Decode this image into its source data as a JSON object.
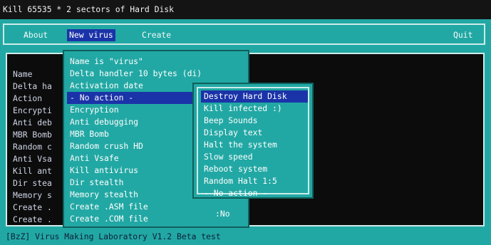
{
  "window": {
    "title": "Kill 65535 * 2 sectors of Hard Disk"
  },
  "menu": {
    "items": [
      {
        "hk": "A",
        "rest": "bout"
      },
      {
        "hk": "N",
        "rest": "ew virus"
      },
      {
        "hk": "C",
        "rest": "reate"
      },
      {
        "hk": "Q",
        "rest": "uit"
      }
    ]
  },
  "options_list": [
    "Name",
    "Delta ha",
    "Action",
    "Encrypti",
    "Anti deb",
    "MBR Bomb",
    "Random c",
    "Anti Vsa",
    "Kill ant",
    "Dir stea",
    "Memory s",
    "Create .",
    "Create ."
  ],
  "new_virus_menu": [
    {
      "hk": "N",
      "rest": "ame is \"virus\""
    },
    {
      "hk": "D",
      "rest": "elta handler 10 bytes (di)"
    },
    {
      "hk": "A",
      "rest": "ctivation date"
    },
    {
      "hk": "",
      "rest": "- No action -"
    },
    {
      "hk": "E",
      "rest": "ncryption"
    },
    {
      "hk": "A",
      "rest": "nti debugging"
    },
    {
      "hk": "M",
      "rest": "BR Bomb"
    },
    {
      "hk": "R",
      "rest": "andom crush HD"
    },
    {
      "hk": "A",
      "rest": "nti Vsafe"
    },
    {
      "hk": "K",
      "rest": "ill antivirus"
    },
    {
      "hk": "D",
      "rest": "ir stealth"
    },
    {
      "hk": "M",
      "rest": "emory stealth"
    },
    {
      "hk": "C",
      "rest": "reate .ASM file"
    },
    {
      "hk": "C",
      "rest": "reate .COM file"
    }
  ],
  "action_menu": [
    {
      "hk": "",
      "rest": "Destroy Hard Disk"
    },
    {
      "hk": "K",
      "rest": "ill infected :)"
    },
    {
      "hk": "B",
      "rest": "eep Sounds"
    },
    {
      "hk": "D",
      "rest": "isplay text"
    },
    {
      "hk": "H",
      "rest": "alt the system"
    },
    {
      "hk": "S",
      "rest": "low speed"
    },
    {
      "hk": "R",
      "rest": "eboot system"
    },
    {
      "hk": "R",
      "rest": "andom Halt 1:5"
    },
    {
      "hk": "",
      "rest": "- No action -"
    }
  ],
  "create_com_value": ":No",
  "status_bar": "[BzZ] Virus Making Laboratory V1.2 Beta test",
  "colors": {
    "background": "#22a8a4",
    "selection": "#1b33a8",
    "text": "#ffffff"
  }
}
